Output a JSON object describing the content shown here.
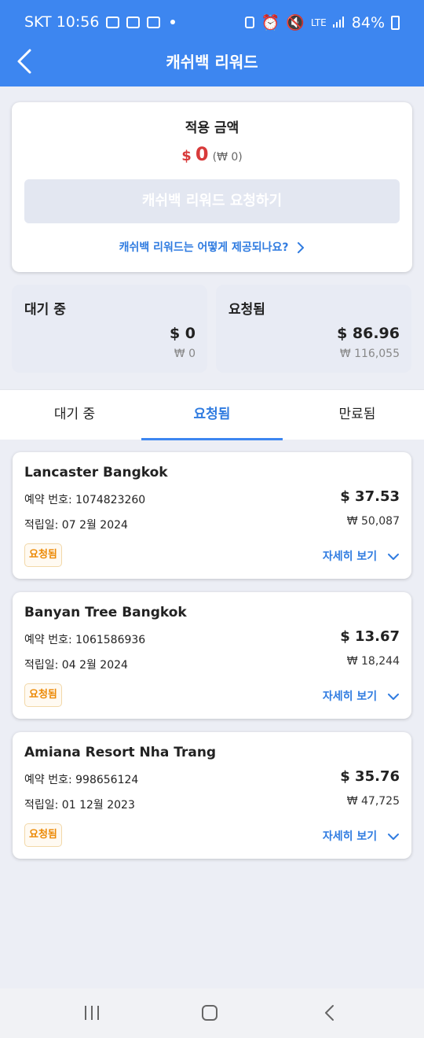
{
  "status_bar": {
    "carrier_time": "SKT 10:56",
    "network": "LTE",
    "battery": "84%"
  },
  "header": {
    "title": "캐쉬백 리워드"
  },
  "summary": {
    "label": "적용 금액",
    "currency_symbol": "$",
    "amount": "0",
    "krw": "(₩ 0)",
    "request_button": "캐쉬백 리워드 요청하기",
    "how_link": "캐쉬백 리워드는 어떻게 제공되나요?"
  },
  "stats": {
    "pending": {
      "label": "대기 중",
      "usd": "$ 0",
      "krw": "₩ 0"
    },
    "requested": {
      "label": "요청됨",
      "usd": "$ 86.96",
      "krw": "₩ 116,055"
    }
  },
  "tabs": [
    {
      "label": "대기 중"
    },
    {
      "label": "요청됨"
    },
    {
      "label": "만료됨"
    }
  ],
  "items": [
    {
      "name": "Lancaster Bangkok",
      "booking": "예약 번호: 1074823260",
      "date": "적립일: 07 2월 2024",
      "usd": "$ 37.53",
      "krw": "₩ 50,087",
      "badge": "요청됨",
      "more": "자세히 보기"
    },
    {
      "name": "Banyan Tree Bangkok",
      "booking": "예약 번호: 1061586936",
      "date": "적립일: 04 2월 2024",
      "usd": "$ 13.67",
      "krw": "₩ 18,244",
      "badge": "요청됨",
      "more": "자세히 보기"
    },
    {
      "name": "Amiana Resort Nha Trang",
      "booking": "예약 번호: 998656124",
      "date": "적립일: 01 12월 2023",
      "usd": "$ 35.76",
      "krw": "₩ 47,725",
      "badge": "요청됨",
      "more": "자세히 보기"
    }
  ],
  "colors": {
    "header": "#3d86f0",
    "accent": "#2f7be0",
    "amount": "#d83a3a",
    "badge": "#ec8a07"
  }
}
